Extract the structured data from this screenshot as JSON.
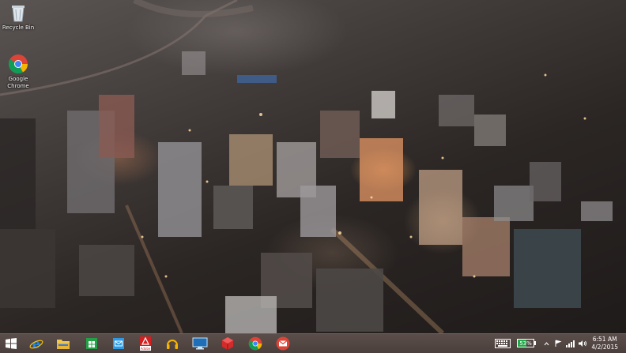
{
  "desktop": {
    "icons": [
      {
        "label": "Recycle Bin",
        "icon": "recycle-bin-icon"
      },
      {
        "label": "Google Chrome",
        "icon": "chrome-icon"
      }
    ]
  },
  "taskbar": {
    "pinned": [
      {
        "name": "start-button",
        "icon": "windows-logo-icon"
      },
      {
        "name": "internet-explorer-button",
        "icon": "internet-explorer-icon"
      },
      {
        "name": "file-explorer-button",
        "icon": "folder-icon"
      },
      {
        "name": "store-button",
        "icon": "store-icon"
      },
      {
        "name": "mail-app-button",
        "icon": "mail-icon"
      },
      {
        "name": "adobe-reader-button",
        "icon": "adobe-icon",
        "label": "Adobe"
      },
      {
        "name": "music-button",
        "icon": "headphones-icon"
      },
      {
        "name": "remote-desktop-button",
        "icon": "monitor-icon"
      },
      {
        "name": "3d-app-button",
        "icon": "red-cube-icon"
      },
      {
        "name": "chrome-button",
        "icon": "chrome-icon"
      },
      {
        "name": "gmail-button",
        "icon": "gmail-icon"
      }
    ],
    "tray": {
      "battery_percent": "53%",
      "battery_level": 0.53,
      "time": "6:51 AM",
      "date": "4/2/2015"
    }
  },
  "colors": {
    "taskbar": "#4f4441",
    "battery_green": "#23a94a",
    "ie_blue": "#1e88e5",
    "store_green": "#24a148",
    "adobe_red": "#d21f1f",
    "gmail_red": "#db4437"
  }
}
